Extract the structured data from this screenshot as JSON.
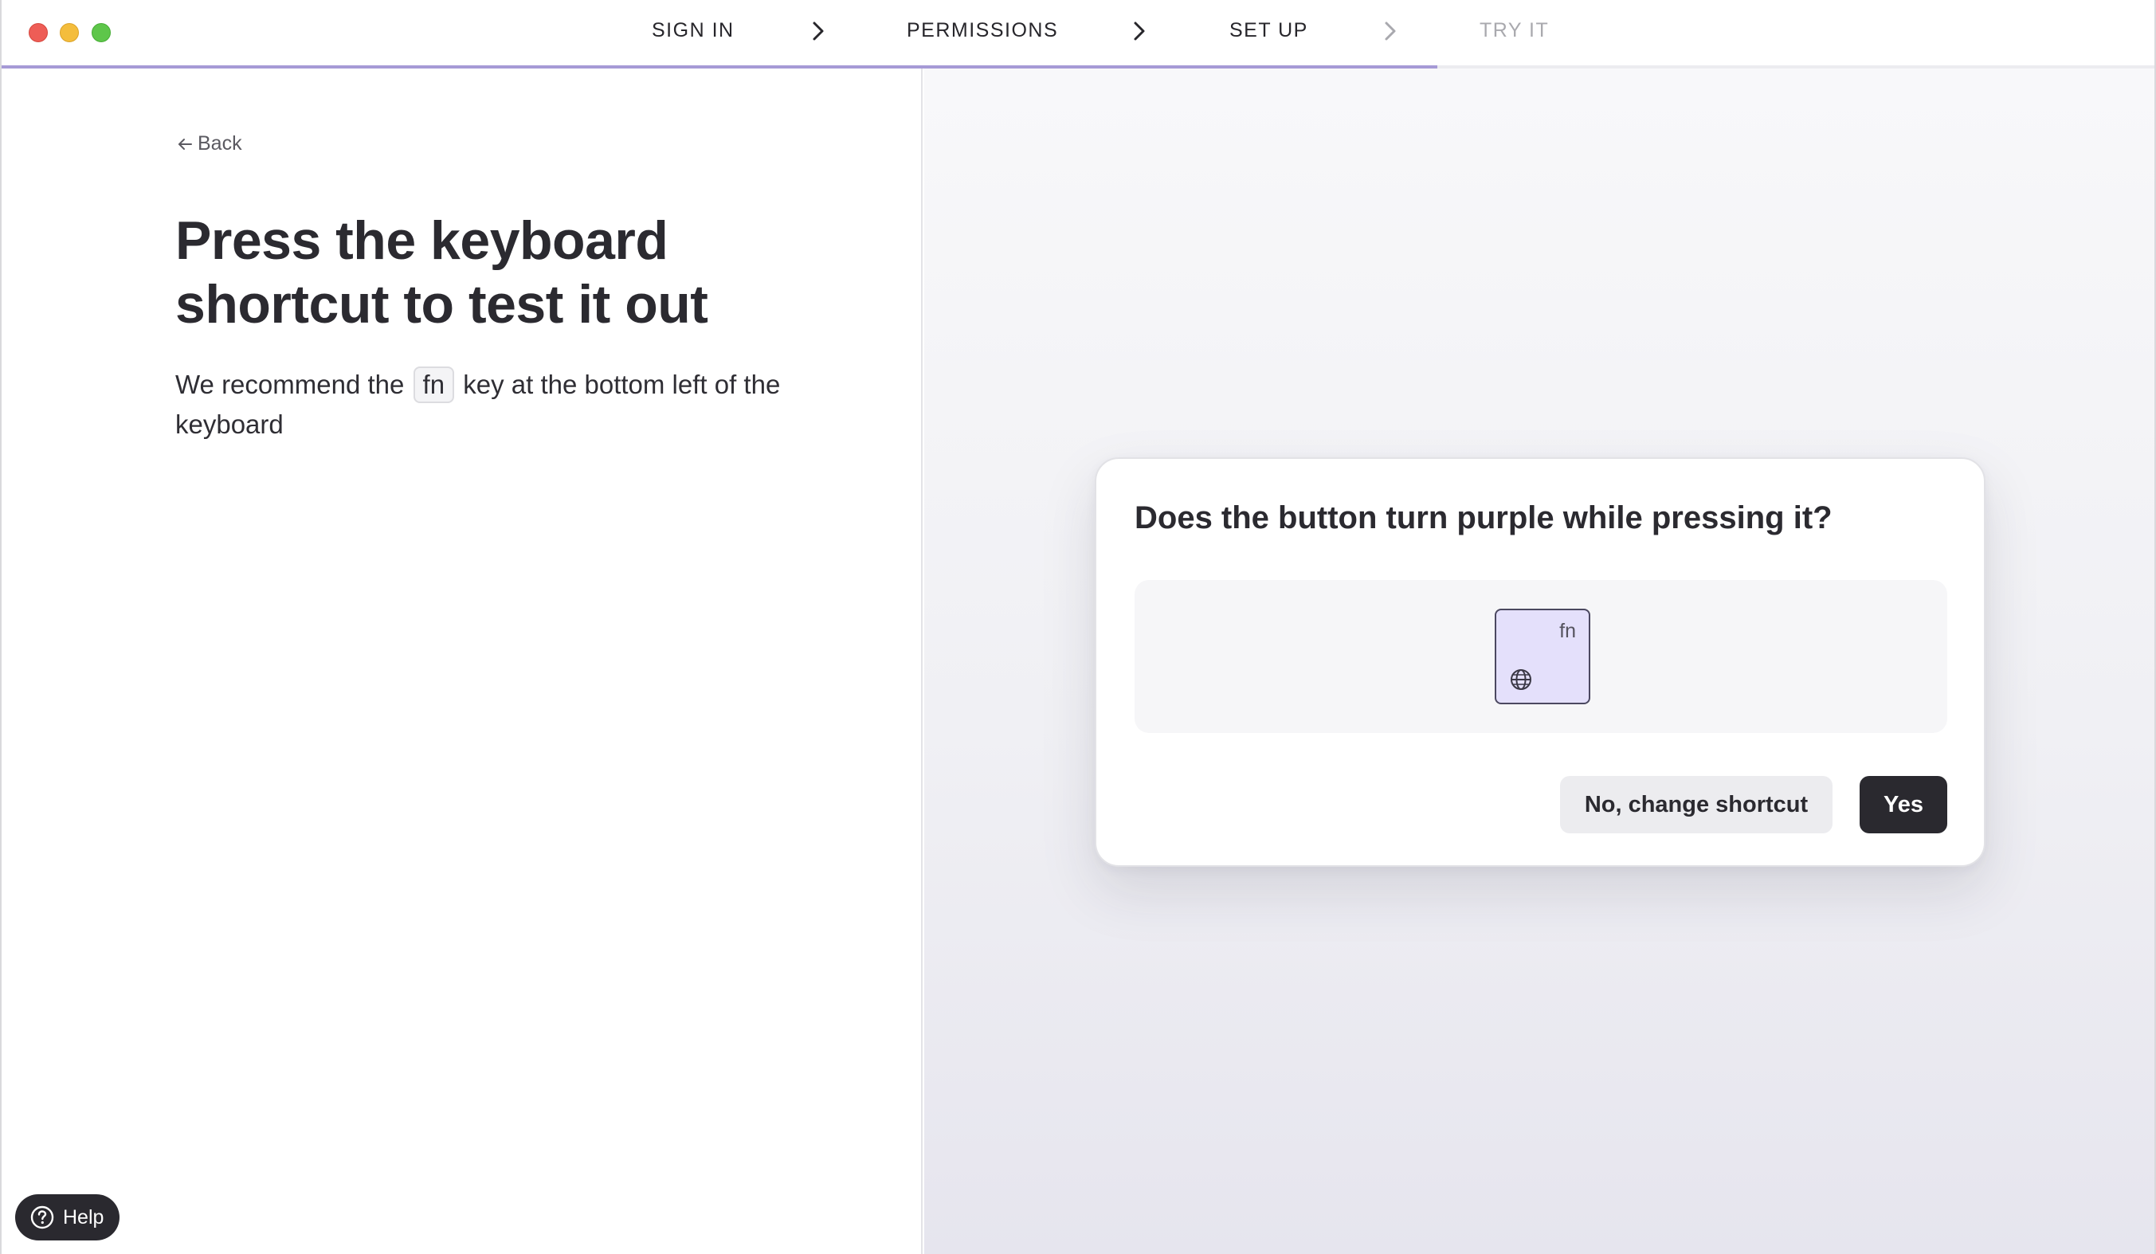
{
  "steps": [
    {
      "label": "SIGN IN",
      "state": "done"
    },
    {
      "label": "PERMISSIONS",
      "state": "done"
    },
    {
      "label": "SET UP",
      "state": "current"
    },
    {
      "label": "TRY IT",
      "state": "upcoming"
    }
  ],
  "progress": {
    "fraction": 0.667,
    "color": "#a69ad6"
  },
  "left": {
    "back_label": "Back",
    "headline": "Press the keyboard shortcut to test it out",
    "description_before": "We recommend the",
    "description_key": "fn",
    "description_after": "key at the bottom left of the keyboard"
  },
  "dialog": {
    "title": "Does the button turn purple while pressing it?",
    "key_label": "fn",
    "key_icon": "globe-icon",
    "key_highlight_color": "#e4e0fb",
    "secondary_button": "No, change shortcut",
    "primary_button": "Yes"
  },
  "help": {
    "label": "Help",
    "icon": "question-circle-icon"
  },
  "colors": {
    "accent": "#a69ad6",
    "dark_button": "#2a292f",
    "traffic_close": "#ee5d56",
    "traffic_minimize": "#f4bd3c",
    "traffic_maximize": "#5ec64a"
  }
}
